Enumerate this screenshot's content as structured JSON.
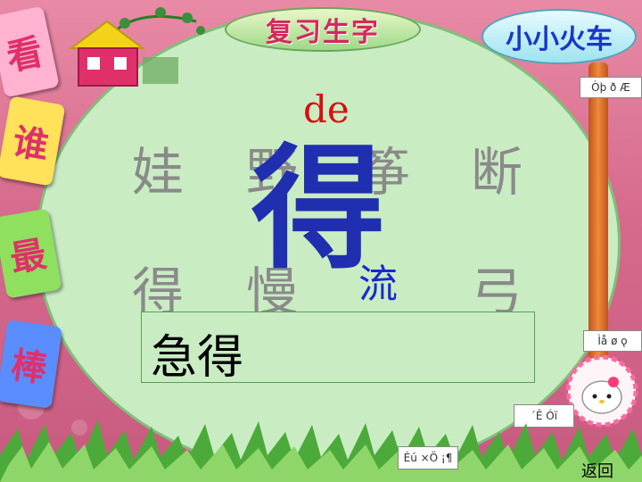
{
  "header": {
    "title": "复习生字",
    "train_label": "小小火车"
  },
  "side_cards": [
    {
      "label": "看",
      "color": "#ffb3d1"
    },
    {
      "label": "谁",
      "color": "#ffe15a"
    },
    {
      "label": "最",
      "color": "#8ee05e"
    },
    {
      "label": "棒",
      "color": "#5a8dff"
    }
  ],
  "lesson": {
    "pinyin": "de",
    "highlight_char": "得",
    "row1": [
      "娃",
      "野",
      "筝",
      "断"
    ],
    "row2": [
      "得",
      "慢",
      "流",
      "弓"
    ],
    "word": "急得"
  },
  "buttons": {
    "top_right": "Òþ ð Æ",
    "mid_right": "Ìå ø ǫ",
    "lower_right": "´Ê Óï",
    "bottom_center": "Éú ×Ö ¡¶",
    "return": "返回"
  },
  "colors": {
    "pinyin": "#d80f0f",
    "highlight": "#1f2fb0",
    "gray_char": "#8a8a8a",
    "oval_bg": "#c9ecc3"
  }
}
